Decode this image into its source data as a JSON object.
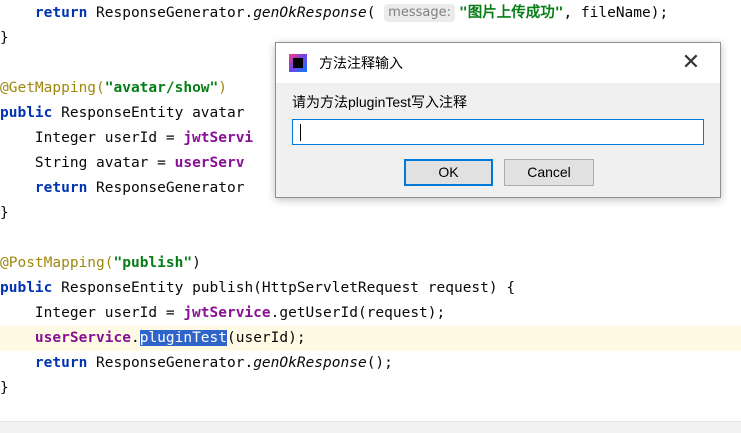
{
  "editor": {
    "lines": {
      "l1": {
        "ret": "return",
        "call": " ResponseGenerator.",
        "method": "genOkResponse",
        "open": "(",
        "hint": "message:",
        "str": "\"图片上传成功\"",
        "rest": ", fileName);"
      },
      "l2": "}",
      "l3": {
        "ann": "@GetMapping(",
        "str": "\"avatar/show\"",
        "close": ")"
      },
      "l4": {
        "kw": "public",
        "rest": " ResponseEntity avatar"
      },
      "l5": {
        "pre": "    Integer userId = ",
        "fld": "jwtServi"
      },
      "l6": {
        "pre": "    String avatar = ",
        "fld": "userServ"
      },
      "l7": {
        "kw": "return",
        "rest": " ResponseGenerator"
      },
      "l8": "}",
      "l9": {
        "ann": "@PostMapping(",
        "str": "\"publish\"",
        "close": ")"
      },
      "l10": {
        "kw": "public",
        "rest": " ResponseEntity publish(HttpServletRequest request) {"
      },
      "l11": {
        "pre": "    Integer userId = ",
        "fld": "jwtService",
        "rest": ".getUserId(request);"
      },
      "l12": {
        "fld": "userService",
        "dot": ".",
        "sel": "pluginTest",
        "rest": "(userId);"
      },
      "l13": {
        "kw": "return",
        "call": " ResponseGenerator.",
        "method": "genOkResponse",
        "rest": "();"
      },
      "l14": "}"
    }
  },
  "dialog": {
    "title": "方法注释输入",
    "prompt": "请为方法pluginTest写入注释",
    "input_value": "",
    "ok_label": "OK",
    "cancel_label": "Cancel",
    "close_glyph": "✕",
    "icon": "intellij-app-icon"
  }
}
